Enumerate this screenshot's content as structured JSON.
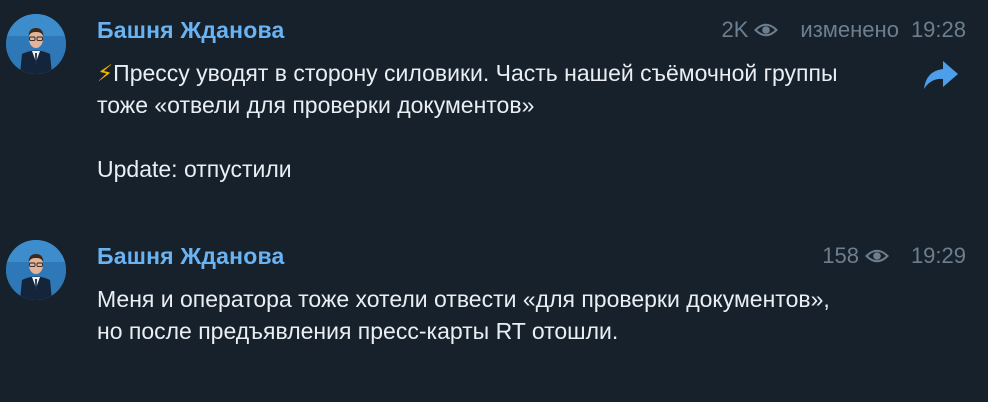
{
  "colors": {
    "background": "#17212b",
    "author": "#6ab3f3",
    "meta": "#6d7f8f",
    "text": "#e9eef3",
    "forward": "#4c9fe8"
  },
  "messages": [
    {
      "author": "Башня Жданова",
      "views": "2K",
      "edited": "изменено",
      "time": "19:28",
      "emoji": "⚡",
      "text": "Прессу уводят в сторону силовики. Часть нашей съёмочной группы тоже «отвели для проверки документов»\n\nUpdate: отпустили",
      "icons": [
        "avatar",
        "eye-icon",
        "forward-arrow-icon"
      ]
    },
    {
      "author": "Башня Жданова",
      "views": "158",
      "time": "19:29",
      "text": "Меня и оператора тоже хотели отвести «для проверки документов», но после предъявления пресс-карты RT отошли.",
      "icons": [
        "avatar",
        "eye-icon"
      ]
    }
  ]
}
